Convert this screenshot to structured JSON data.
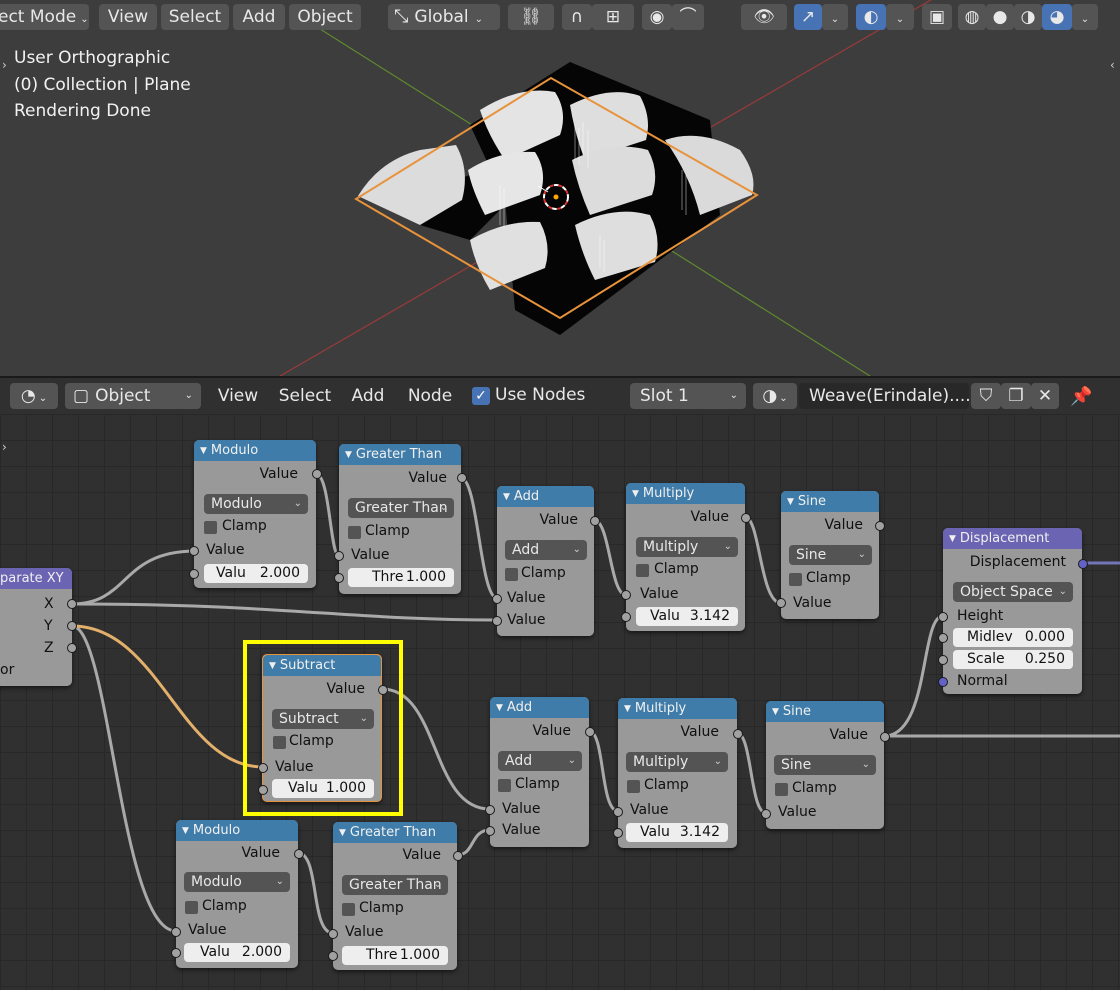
{
  "viewport": {
    "mode_label": "ect Mode",
    "menu": [
      "View",
      "Select",
      "Add",
      "Object"
    ],
    "orientation": "Global",
    "overlay_lines": [
      "User Orthographic",
      "(0) Collection | Plane",
      "Rendering Done"
    ]
  },
  "node_header": {
    "object_label": "Object",
    "menu": [
      "View",
      "Select",
      "Add",
      "Node"
    ],
    "use_nodes_label": "Use Nodes",
    "slot_label": "Slot 1",
    "material_name": "Weave(Erindale)...."
  },
  "nodes": {
    "separate_xy": {
      "title": "parate XY",
      "outputs": [
        "X",
        "Y",
        "Z"
      ],
      "extra": "or"
    },
    "modulo_top": {
      "title": "Modulo",
      "output": "Value",
      "op": "Modulo",
      "clamp": "Clamp",
      "input": "Value",
      "field_key": "Valu",
      "field_value": "2.000"
    },
    "greater_top": {
      "title": "Greater Than",
      "output": "Value",
      "op": "Greater Than",
      "clamp": "Clamp",
      "input": "Value",
      "field_key": "Thre",
      "field_value": "1.000"
    },
    "add_top": {
      "title": "Add",
      "output": "Value",
      "op": "Add",
      "clamp": "Clamp",
      "input1": "Value",
      "input2": "Value"
    },
    "multiply_top": {
      "title": "Multiply",
      "output": "Value",
      "op": "Multiply",
      "clamp": "Clamp",
      "input": "Value",
      "field_key": "Valu",
      "field_value": "3.142"
    },
    "sine_top": {
      "title": "Sine",
      "output": "Value",
      "op": "Sine",
      "clamp": "Clamp",
      "input": "Value"
    },
    "displacement": {
      "title": "Displacement",
      "output": "Displacement",
      "space": "Object Space",
      "height": "Height",
      "midlevel_key": "Midlev",
      "midlevel_value": "0.000",
      "scale_key": "Scale",
      "scale_value": "0.250",
      "normal": "Normal"
    },
    "subtract": {
      "title": "Subtract",
      "output": "Value",
      "op": "Subtract",
      "clamp": "Clamp",
      "input": "Value",
      "field_key": "Valu",
      "field_value": "1.000"
    },
    "add_bot": {
      "title": "Add",
      "output": "Value",
      "op": "Add",
      "clamp": "Clamp",
      "input1": "Value",
      "input2": "Value"
    },
    "multiply_bot": {
      "title": "Multiply",
      "output": "Value",
      "op": "Multiply",
      "clamp": "Clamp",
      "input": "Value",
      "field_key": "Valu",
      "field_value": "3.142"
    },
    "sine_bot": {
      "title": "Sine",
      "output": "Value",
      "op": "Sine",
      "clamp": "Clamp",
      "input": "Value"
    },
    "modulo_bot": {
      "title": "Modulo",
      "output": "Value",
      "op": "Modulo",
      "clamp": "Clamp",
      "input": "Value",
      "field_key": "Valu",
      "field_value": "2.000"
    },
    "greater_bot": {
      "title": "Greater Than",
      "output": "Value",
      "op": "Greater Than",
      "clamp": "Clamp",
      "input": "Value",
      "field_key": "Thre",
      "field_value": "1.000"
    }
  },
  "colors": {
    "highlight": "#ffff00",
    "node_header": "#3f7ca9",
    "vector_header": "#6a64b3",
    "selection_orange": "#e8923b",
    "active_blue": "#4772b3"
  }
}
